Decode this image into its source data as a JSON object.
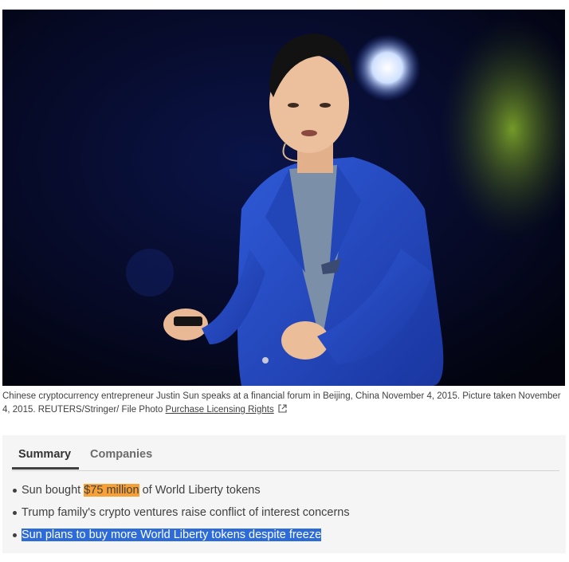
{
  "photo": {
    "alt": "Chinese cryptocurrency entrepreneur Justin Sun speaks at a financial forum"
  },
  "caption": {
    "text": "Chinese cryptocurrency entrepreneur Justin Sun speaks at a financial forum in Beijing, China November 4, 2015. Picture taken November 4, 2015. REUTERS/Stringer/ File Photo",
    "link_label": "Purchase Licensing Rights",
    "link_icon": "external-link-icon"
  },
  "summary": {
    "tabs": [
      {
        "label": "Summary",
        "active": true
      },
      {
        "label": "Companies",
        "active": false
      }
    ],
    "bullets": [
      {
        "before": "Sun bought ",
        "highlight": "$75 million",
        "after": " of World Liberty tokens"
      },
      {
        "text": "Trump family's crypto ventures raise conflict of interest concerns"
      },
      {
        "highlight": "Sun plans to buy more World Liberty tokens despite freeze"
      }
    ]
  },
  "colors": {
    "highlight_orange": "#f7a036",
    "highlight_blue": "#2c6bd8",
    "panel_bg": "#f5f5f5"
  }
}
